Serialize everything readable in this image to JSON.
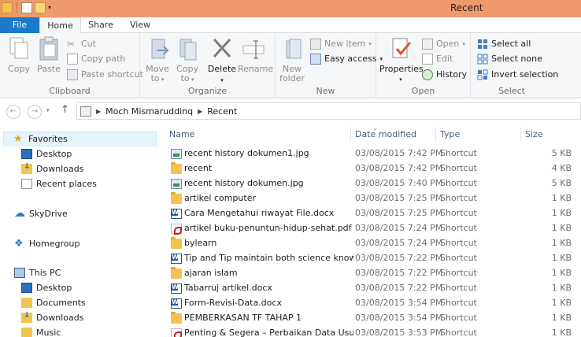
{
  "window": {
    "title": "Recent"
  },
  "ribbon_tabs": [
    "File",
    "Home",
    "Share",
    "View"
  ],
  "ribbon": {
    "clipboard": {
      "label": "Clipboard",
      "copy": "Copy",
      "paste": "Paste",
      "cut": "Cut",
      "copy_path": "Copy path",
      "paste_shortcut": "Paste shortcut"
    },
    "organize": {
      "label": "Organize",
      "move_to": [
        "Move",
        "to"
      ],
      "copy_to": [
        "Copy",
        "to"
      ],
      "delete": "Delete",
      "rename": "Rename"
    },
    "new": {
      "label": "New",
      "new_folder": [
        "New",
        "folder"
      ],
      "new_item": "New item",
      "easy_access": "Easy access"
    },
    "open": {
      "label": "Open",
      "properties": "Properties",
      "open": "Open",
      "edit": "Edit",
      "history": "History"
    },
    "select": {
      "label": "Select",
      "select_all": "Select all",
      "select_none": "Select none",
      "invert_selection": "Invert selection"
    }
  },
  "address": {
    "breadcrumb": [
      "Moch Mismaruddinq",
      "Recent"
    ]
  },
  "nav_pane": {
    "favorites": "Favorites",
    "favorites_items": [
      "Desktop",
      "Downloads",
      "Recent places"
    ],
    "skydrive": "SkyDrive",
    "homegroup": "Homegroup",
    "this_pc": "This PC",
    "this_pc_items": [
      "Desktop",
      "Documents",
      "Downloads",
      "Music"
    ]
  },
  "columns": {
    "name": "Name",
    "date": "Date modified",
    "type": "Type",
    "size": "Size"
  },
  "files": [
    {
      "name": "recent history dokumen1.jpg",
      "date": "03/08/2015 7:42 PM",
      "type": "Shortcut",
      "size": "5 KB",
      "icon": "jpg"
    },
    {
      "name": "recent",
      "date": "03/08/2015 7:42 PM",
      "type": "Shortcut",
      "size": "4 KB",
      "icon": "folder"
    },
    {
      "name": "recent history dokumen.jpg",
      "date": "03/08/2015 7:40 PM",
      "type": "Shortcut",
      "size": "5 KB",
      "icon": "jpg"
    },
    {
      "name": "artikel computer",
      "date": "03/08/2015 7:25 PM",
      "type": "Shortcut",
      "size": "1 KB",
      "icon": "folder"
    },
    {
      "name": "Cara Mengetahui riwayat File.docx",
      "date": "03/08/2015 7:25 PM",
      "type": "Shortcut",
      "size": "1 KB",
      "icon": "docx"
    },
    {
      "name": "artikel buku-penuntun-hidup-sehat.pdf",
      "date": "03/08/2015 7:24 PM",
      "type": "Shortcut",
      "size": "1 KB",
      "icon": "pdf"
    },
    {
      "name": "bylearn",
      "date": "03/08/2015 7:24 PM",
      "type": "Shortcut",
      "size": "1 KB",
      "icon": "folder"
    },
    {
      "name": "Tip and Tip maintain both science knowl...",
      "date": "03/08/2015 7:22 PM",
      "type": "Shortcut",
      "size": "1 KB",
      "icon": "docx"
    },
    {
      "name": "ajaran islam",
      "date": "03/08/2015 7:22 PM",
      "type": "Shortcut",
      "size": "1 KB",
      "icon": "folder"
    },
    {
      "name": "Tabarruj artikel.docx",
      "date": "03/08/2015 7:22 PM",
      "type": "Shortcut",
      "size": "1 KB",
      "icon": "docx"
    },
    {
      "name": "Form-Revisi-Data.docx",
      "date": "03/08/2015 3:54 PM",
      "type": "Shortcut",
      "size": "1 KB",
      "icon": "docx"
    },
    {
      "name": "PEMBERKASAN TF TAHAP 1",
      "date": "03/08/2015 3:54 PM",
      "type": "Shortcut",
      "size": "1 KB",
      "icon": "folder"
    },
    {
      "name": "Penting & Segera – Perbaikan Data Usula...",
      "date": "03/08/2015 3:53 PM",
      "type": "Shortcut",
      "size": "1 KB",
      "icon": "pdf"
    }
  ],
  "colors": {
    "titlebar": "#ef9a6d",
    "file_tab": "#1979ca",
    "selection": "#e5f3fb",
    "folder": "#f2c44f"
  }
}
